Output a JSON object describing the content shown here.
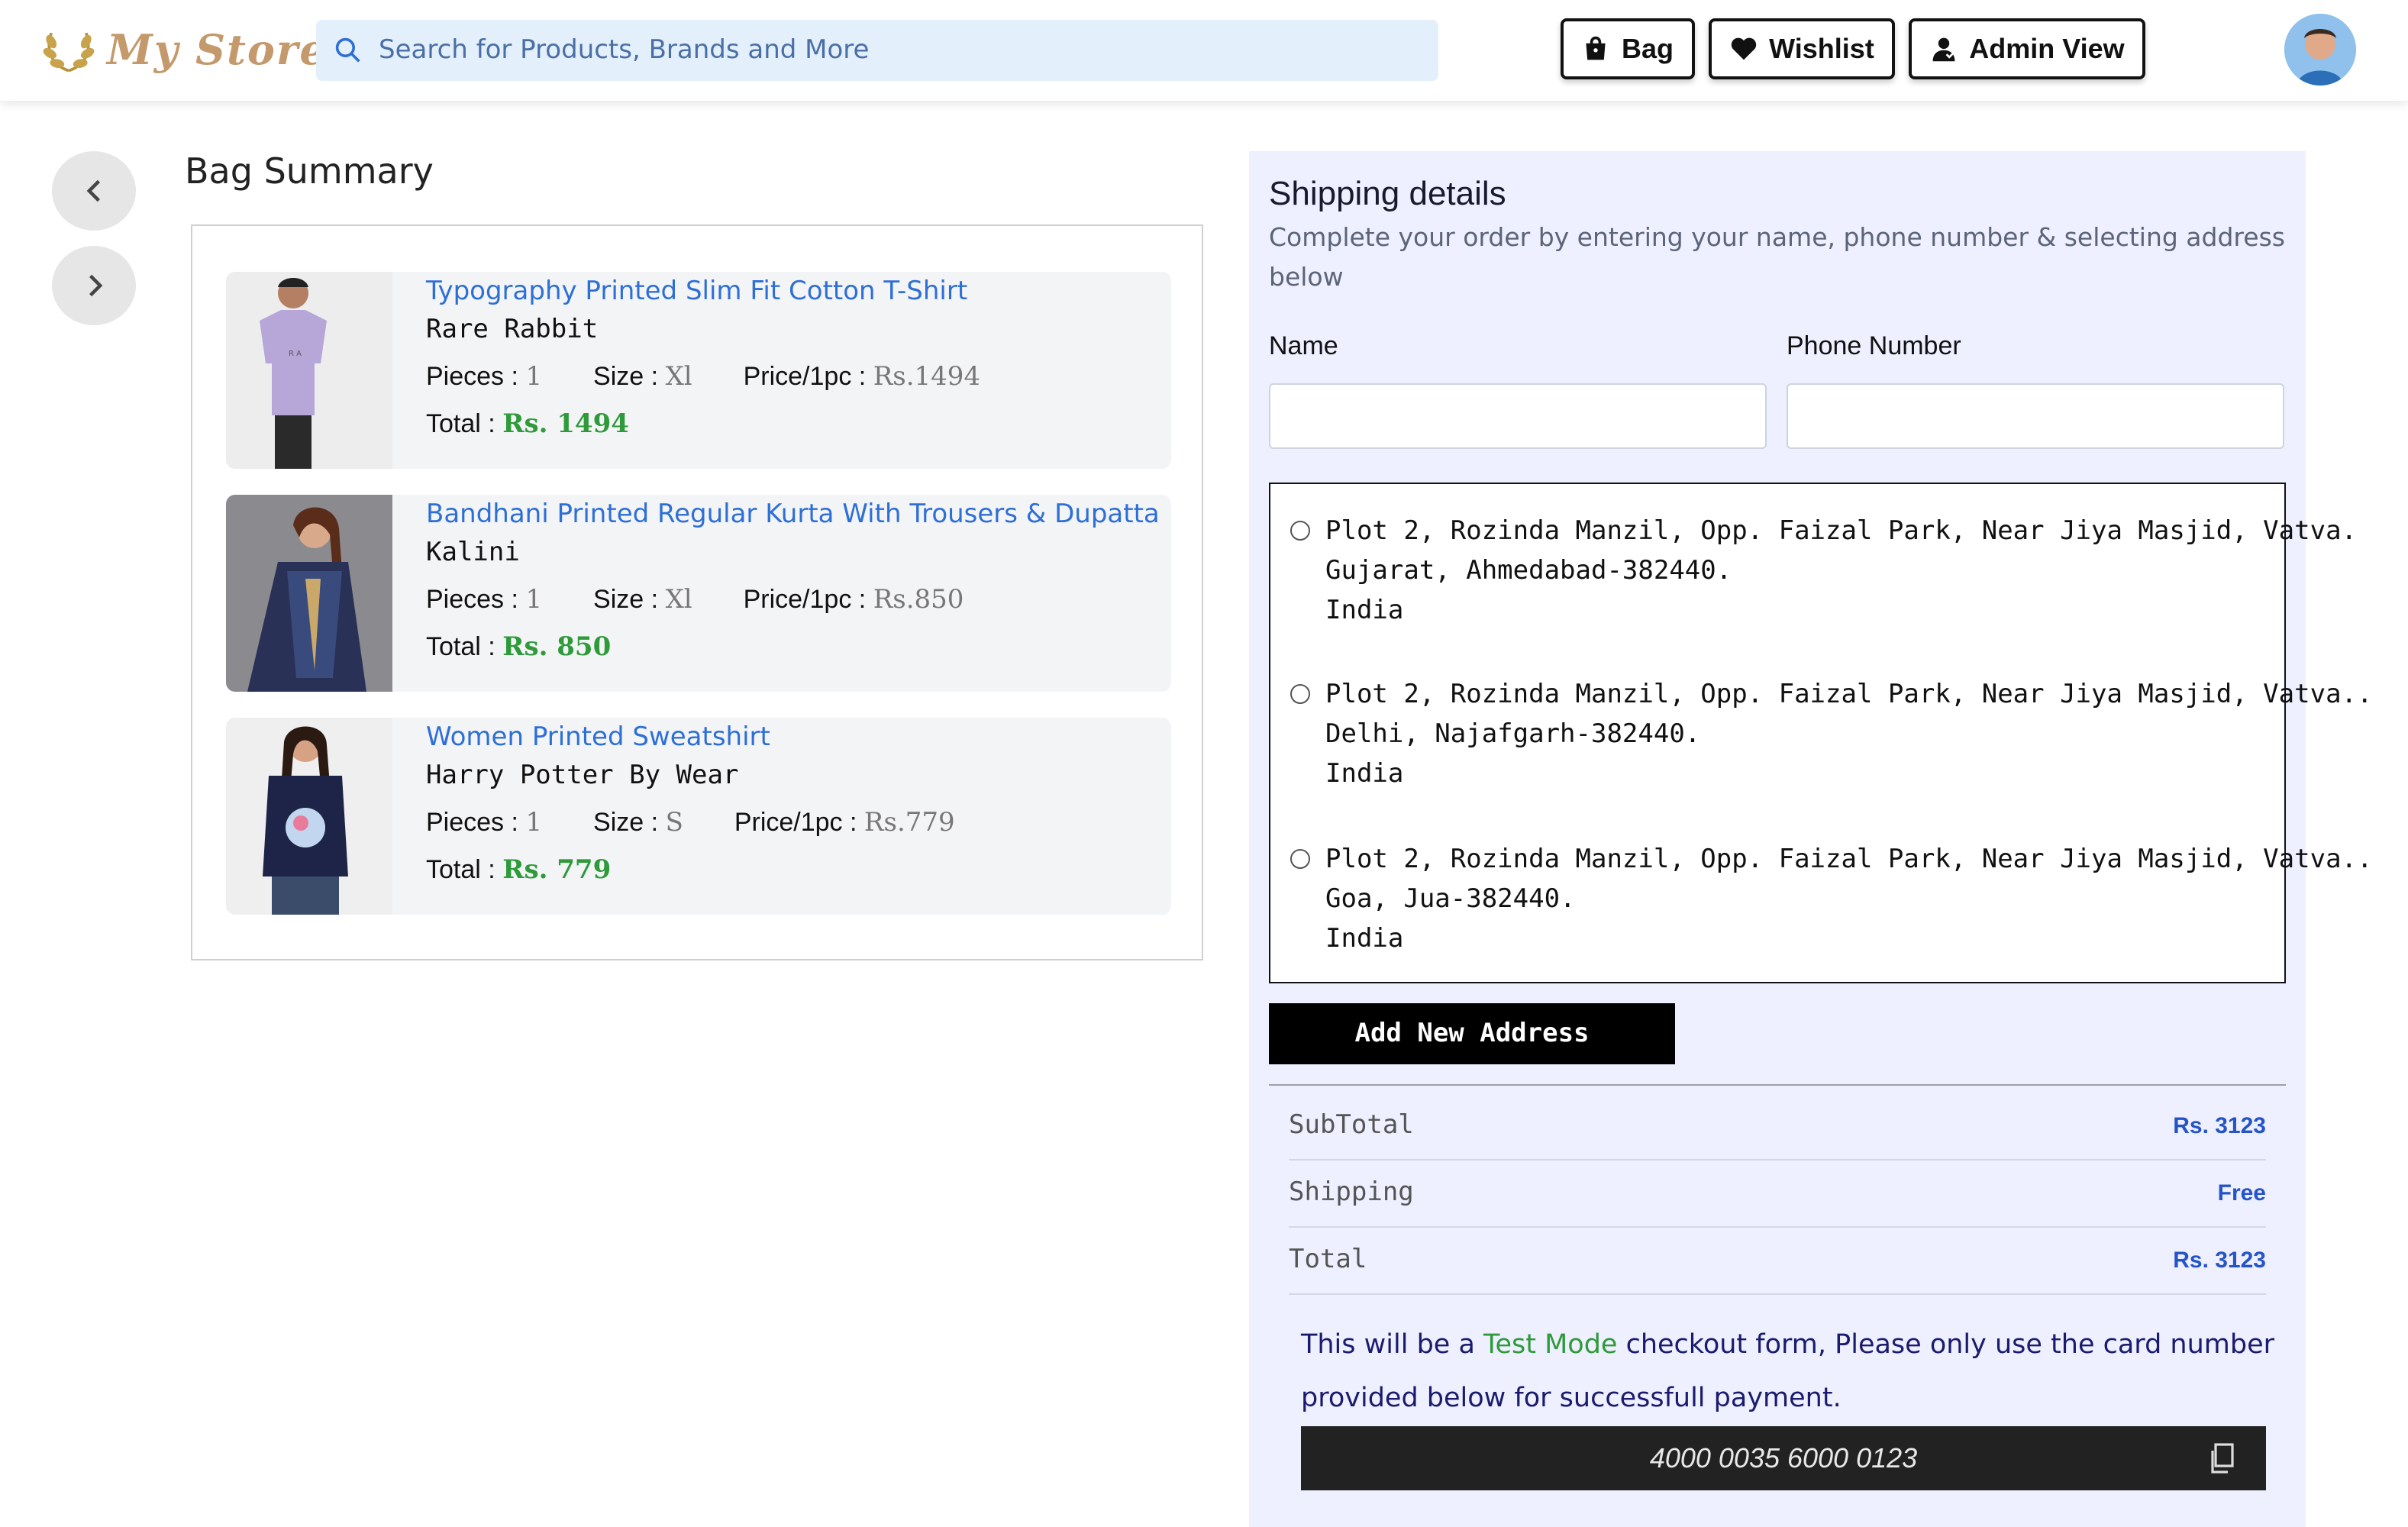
{
  "header": {
    "logo_text": "My Store",
    "search_placeholder": "Search for Products, Brands and More",
    "buttons": {
      "bag": "Bag",
      "wishlist": "Wishlist",
      "admin": "Admin View"
    }
  },
  "bag": {
    "title": "Bag Summary",
    "labels": {
      "pieces": "Pieces :",
      "size": "Size :",
      "price": "Price/1pc :",
      "total": "Total :"
    },
    "items": [
      {
        "name": "Typography Printed Slim Fit Cotton T-Shirt",
        "brand": "Rare Rabbit",
        "pieces": "1",
        "size": "Xl",
        "price": "Rs.1494",
        "total": "Rs. 1494"
      },
      {
        "name": "Bandhani Printed Regular Kurta With Trousers & Dupatta",
        "brand": "Kalini",
        "pieces": "1",
        "size": "Xl",
        "price": "Rs.850",
        "total": "Rs. 850"
      },
      {
        "name": "Women Printed Sweatshirt",
        "brand": "Harry Potter By Wear",
        "pieces": "1",
        "size": "S",
        "price": "Rs.779",
        "total": "Rs. 779"
      }
    ]
  },
  "shipping": {
    "title": "Shipping details",
    "subtitle": "Complete your order by entering your name, phone number & selecting address below",
    "name_label": "Name",
    "phone_label": "Phone Number",
    "addresses": [
      {
        "line1": "Plot 2, Rozinda Manzil, Opp. Faizal Park, Near Jiya Masjid, Vatva.",
        "line2": "Gujarat, Ahmedabad-382440.",
        "line3": "India"
      },
      {
        "line1": "Plot 2, Rozinda Manzil, Opp. Faizal Park, Near Jiya Masjid, Vatva..",
        "line2": "Delhi, Najafgarh-382440.",
        "line3": "India"
      },
      {
        "line1": "Plot 2, Rozinda Manzil, Opp. Faizal Park, Near Jiya Masjid, Vatva..",
        "line2": "Goa, Jua-382440.",
        "line3": "India"
      }
    ],
    "add_address": "Add New Address",
    "summary": [
      {
        "label": "SubTotal",
        "value": "Rs. 3123"
      },
      {
        "label": "Shipping",
        "value": "Free"
      },
      {
        "label": "Total",
        "value": "Rs. 3123"
      }
    ],
    "note_before": "This will be a ",
    "note_highlight": "Test Mode",
    "note_after": " checkout form, Please only use the card number provided below for successfull payment.",
    "card_number": "4000 0035 6000 0123"
  },
  "icons": [
    "logo-wreath-icon",
    "search-icon",
    "bag-icon",
    "heart-icon",
    "user-icon",
    "chevron-left-icon",
    "chevron-right-icon",
    "copy-icon"
  ],
  "colors": {
    "accent_blue": "#2e6fd6",
    "price_green": "#2e9a3a",
    "panel_bg": "#eeefff",
    "search_bg": "#e3f0fb"
  }
}
